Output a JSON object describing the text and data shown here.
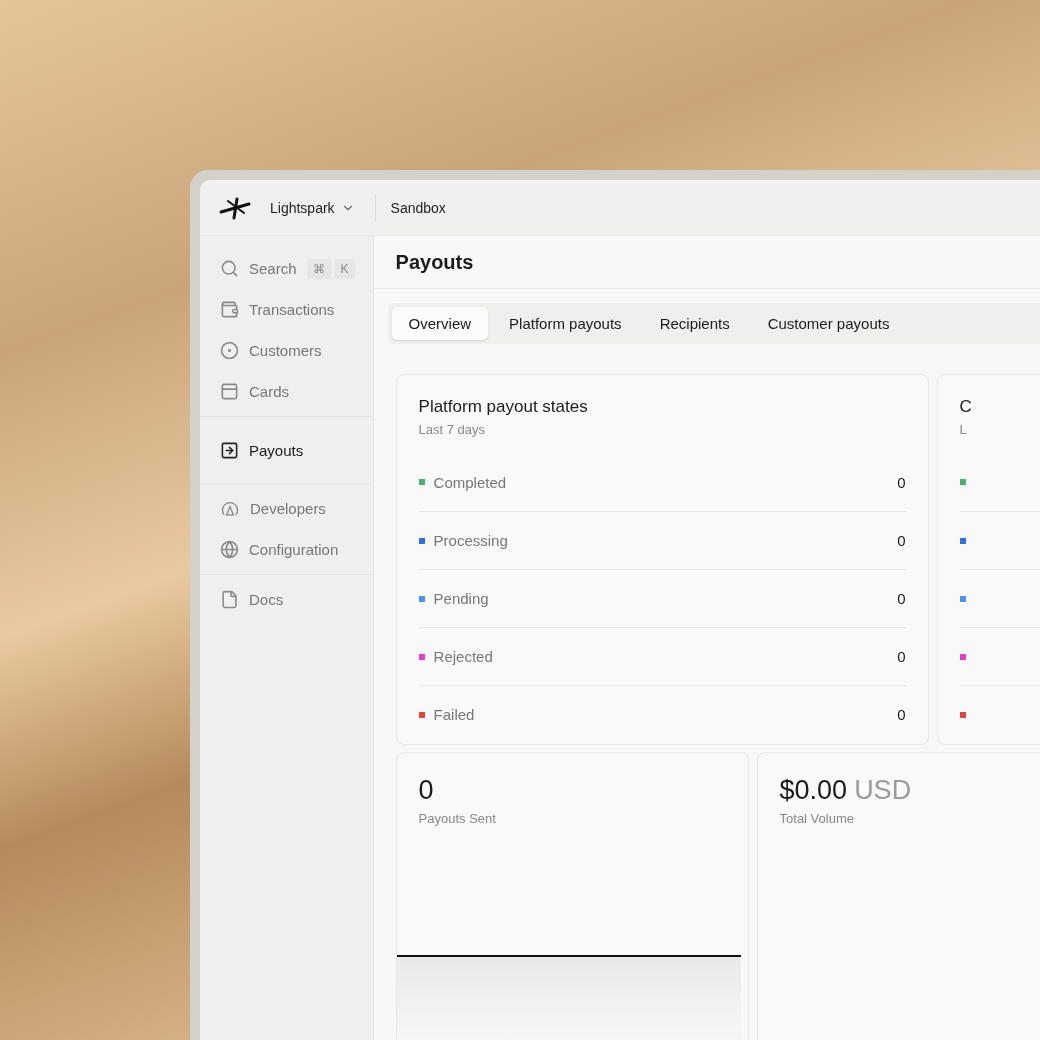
{
  "topbar": {
    "org": "Lightspark",
    "environment": "Sandbox"
  },
  "sidebar": {
    "search": {
      "label": "Search",
      "keys": [
        "⌘",
        "K"
      ]
    },
    "groups": [
      [
        {
          "label": "Transactions",
          "selected": false
        },
        {
          "label": "Customers",
          "selected": false
        },
        {
          "label": "Cards",
          "selected": false
        }
      ],
      [
        {
          "label": "Payouts",
          "selected": true
        }
      ],
      [
        {
          "label": "Developers",
          "selected": false
        },
        {
          "label": "Configuration",
          "selected": false
        }
      ],
      [
        {
          "label": "Docs",
          "selected": false
        }
      ]
    ]
  },
  "page_title": "Payouts",
  "tabs": [
    {
      "label": "Overview",
      "selected": true
    },
    {
      "label": "Platform payouts",
      "selected": false
    },
    {
      "label": "Recipients",
      "selected": false
    },
    {
      "label": "Customer payouts",
      "selected": false
    }
  ],
  "state_cards": [
    {
      "title": "Platform payout states",
      "subtitle": "Last 7 days",
      "rows": [
        {
          "label": "Completed",
          "value": "0",
          "color": "#4caf6e"
        },
        {
          "label": "Processing",
          "value": "0",
          "color": "#2f6fd6"
        },
        {
          "label": "Pending",
          "value": "0",
          "color": "#4a94ee"
        },
        {
          "label": "Rejected",
          "value": "0",
          "color": "#e03fd0"
        },
        {
          "label": "Failed",
          "value": "0",
          "color": "#e0483c"
        }
      ]
    },
    {
      "title": "C",
      "subtitle": "L",
      "rows": [
        {
          "color": "#4caf6e"
        },
        {
          "color": "#2f6fd6"
        },
        {
          "color": "#4a94ee"
        },
        {
          "color": "#e03fd0"
        },
        {
          "color": "#e0483c"
        }
      ]
    }
  ],
  "stats": [
    {
      "value": "0",
      "label": "Payouts Sent"
    },
    {
      "value": "$0.00",
      "unit": "USD",
      "label": "Total Volume"
    }
  ]
}
